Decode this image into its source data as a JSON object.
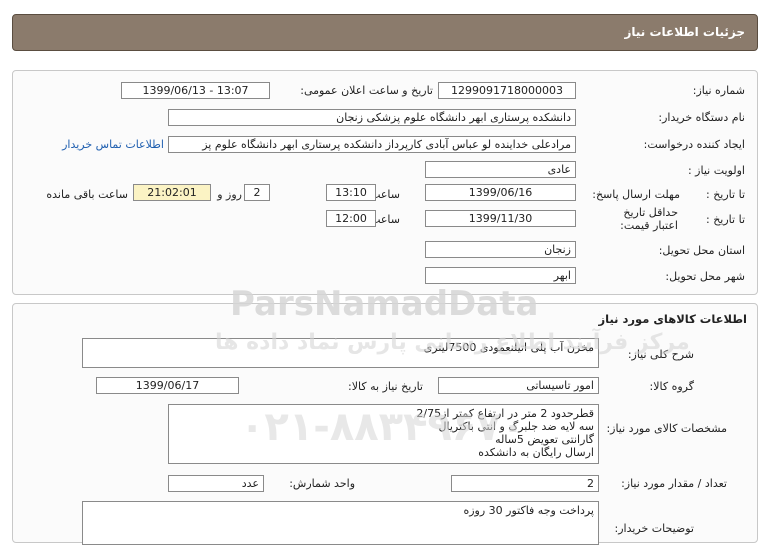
{
  "header": {
    "title": "جزئیات اطلاعات نیاز"
  },
  "info": {
    "need_number_label": "شماره نیاز:",
    "need_number": "1299091718000003",
    "announce_label": "تاریخ و ساعت اعلان عمومی:",
    "announce_value": "1399/06/13 - 13:07",
    "buyer_label": "نام دستگاه خریدار:",
    "buyer_value": "دانشکده پرستاری ابهر دانشگاه علوم پزشکی زنجان",
    "creator_label": "ایجاد کننده درخواست:",
    "creator_value": "مرادعلی خداینده لو عباس آبادی کارپرداز دانشکده پرستاری ابهر دانشگاه علوم پز",
    "contact_link": "اطلاعات تماس خریدار",
    "priority_label": "اولویت نیاز :",
    "priority_value": "عادی",
    "reply_deadline_label": "مهلت ارسال پاسخ:",
    "to_date_label": "تا تاریخ :",
    "reply_date": "1399/06/16",
    "time_label": "ساعت",
    "reply_time": "13:10",
    "days_value": "2",
    "days_label": "روز و",
    "remaining_time": "21:02:01",
    "remaining_label": "ساعت باقی مانده",
    "validity_label": "حداقل تاریخ اعتبار قیمت:",
    "validity_to_label": "تا تاریخ :",
    "validity_date": "1399/11/30",
    "validity_time_label": "ساعت",
    "validity_time": "12:00",
    "province_label": "استان محل تحویل:",
    "province_value": "زنجان",
    "city_label": "شهر محل تحویل:",
    "city_value": "ابهر"
  },
  "goods": {
    "title": "اطلاعات کالاهای مورد نیاز",
    "summary_label": "شرح کلی نیاز:",
    "summary_value": "مخزن آب پلی اتیلنعمودی 7500لیتری",
    "group_label": "گروه کالا:",
    "group_value": "امور تاسیساتی",
    "need_date_label": "تاریخ نیاز به کالا:",
    "need_date_value": "1399/06/17",
    "specs_label": "مشخصات کالای مورد نیاز:",
    "specs_lines": [
      "قطرحدود 2 متر در ارتفاع کمتر از2/75",
      "سه لایه ضد جلبرگ و انتی باکتریال",
      "گارانتی تعویض 5ساله",
      "ارسال رایگان به دانشکده"
    ],
    "qty_label": "تعداد / مقدار مورد نیاز:",
    "qty_value": "2",
    "unit_label": "واحد شمارش:",
    "unit_value": "عدد",
    "desc_label": "توضیحات خریدار:",
    "desc_value": "پرداخت وجه فاکتور 30 روزه"
  },
  "watermark": {
    "brand": "ParsNamadData",
    "persian": "مرکز فرآیند اطلاع رسانی پارس نماد داده ها",
    "phone": "۰۲۱-۸۸۳۴۹۶۷۰"
  }
}
